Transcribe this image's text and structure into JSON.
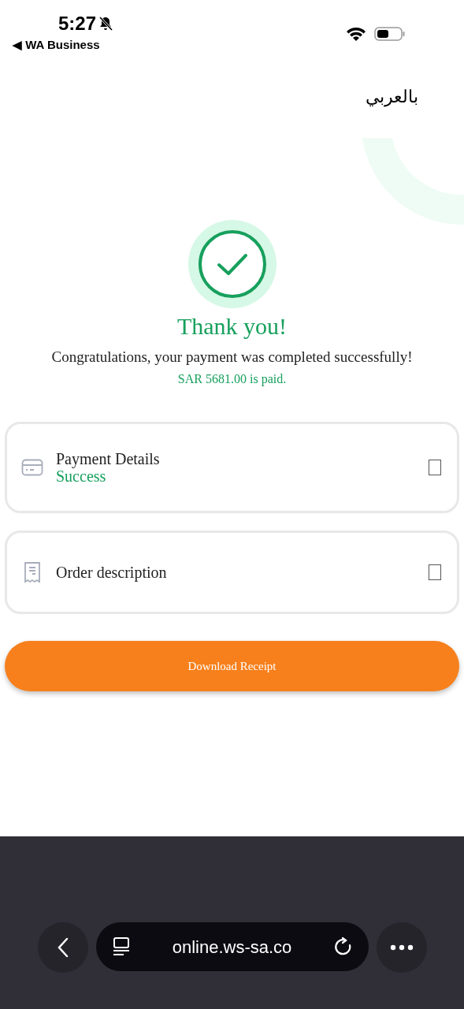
{
  "status_bar": {
    "time": "5:27",
    "back_app": "◀ WA Business"
  },
  "language_link": "بالعربي",
  "title": "Thank you!",
  "message": "Congratulations, your payment was completed successfully!",
  "amount": "SAR 5681.00 is paid.",
  "cards": [
    {
      "kind": "card",
      "title": "Payment Details",
      "status": "Success",
      "checked": false
    },
    {
      "kind": "receipt",
      "title": "Order description",
      "checked": false
    }
  ],
  "download_button": "Download Receipt",
  "browser": {
    "url": "online.ws-sa.co"
  }
}
